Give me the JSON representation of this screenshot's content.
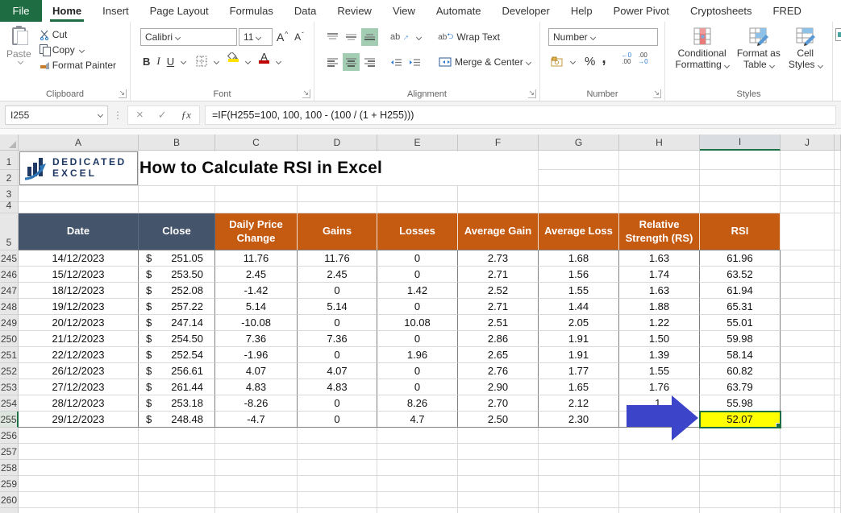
{
  "tabs": {
    "file": "File",
    "items": [
      {
        "label": "Home",
        "active": true
      },
      {
        "label": "Insert",
        "active": false
      },
      {
        "label": "Page Layout",
        "active": false
      },
      {
        "label": "Formulas",
        "active": false
      },
      {
        "label": "Data",
        "active": false
      },
      {
        "label": "Review",
        "active": false
      },
      {
        "label": "View",
        "active": false
      },
      {
        "label": "Automate",
        "active": false
      },
      {
        "label": "Developer",
        "active": false
      },
      {
        "label": "Help",
        "active": false
      },
      {
        "label": "Power Pivot",
        "active": false
      },
      {
        "label": "Cryptosheets",
        "active": false
      },
      {
        "label": "FRED",
        "active": false
      }
    ]
  },
  "ribbon": {
    "clipboard": {
      "title": "Clipboard",
      "paste": "Paste",
      "cut": "Cut",
      "copy": "Copy",
      "format_painter": "Format Painter"
    },
    "font": {
      "title": "Font",
      "font_name": "Calibri",
      "font_size": "11",
      "bold": "B",
      "italic": "I",
      "underline": "U"
    },
    "alignment": {
      "title": "Alignment",
      "wrap_text": "Wrap Text",
      "merge_center": "Merge & Center",
      "ab": "ab"
    },
    "number": {
      "title": "Number",
      "format": "Number",
      "percent": "%",
      "comma": ",",
      "inc_top": "←0",
      "inc_bot": ".00",
      "dec_top": ".00",
      "dec_bot": "→0"
    },
    "styles": {
      "title": "Styles",
      "conditional_line1": "Conditional",
      "conditional_line2": "Formatting",
      "format_table_line1": "Format as",
      "format_table_line2": "Table",
      "cell_styles_line1": "Cell",
      "cell_styles_line2": "Styles"
    }
  },
  "formula_bar": {
    "name_box": "I255",
    "cancel": "×",
    "enter": "✓",
    "fx": "ƒx",
    "formula": "=IF(H255=100, 100, 100 - (100 / (1 + H255)))"
  },
  "sheet": {
    "title": "How to Calculate RSI in Excel",
    "logo": {
      "line1": "DEDICATED",
      "line2": "EXCEL"
    },
    "columns": [
      "A",
      "B",
      "C",
      "D",
      "E",
      "F",
      "G",
      "H",
      "I",
      "J"
    ],
    "selected_column": "I",
    "selected_row": "255",
    "selected_cell": "I255",
    "top_row_numbers": [
      "1",
      "2",
      "3",
      "4",
      "5"
    ],
    "table_headers": [
      "Date",
      "Close",
      "Daily Price Change",
      "Gains",
      "Losses",
      "Average Gain",
      "Average Loss",
      "Relative Strength (RS)",
      "RSI"
    ],
    "currency_symbol": "$",
    "rows": [
      {
        "num": "245",
        "date": "14/12/2023",
        "close": "251.05",
        "values": [
          "11.76",
          "11.76",
          "0",
          "2.73",
          "1.68",
          "1.63",
          "61.96"
        ]
      },
      {
        "num": "246",
        "date": "15/12/2023",
        "close": "253.50",
        "values": [
          "2.45",
          "2.45",
          "0",
          "2.71",
          "1.56",
          "1.74",
          "63.52"
        ]
      },
      {
        "num": "247",
        "date": "18/12/2023",
        "close": "252.08",
        "values": [
          "-1.42",
          "0",
          "1.42",
          "2.52",
          "1.55",
          "1.63",
          "61.94"
        ]
      },
      {
        "num": "248",
        "date": "19/12/2023",
        "close": "257.22",
        "values": [
          "5.14",
          "5.14",
          "0",
          "2.71",
          "1.44",
          "1.88",
          "65.31"
        ]
      },
      {
        "num": "249",
        "date": "20/12/2023",
        "close": "247.14",
        "values": [
          "-10.08",
          "0",
          "10.08",
          "2.51",
          "2.05",
          "1.22",
          "55.01"
        ]
      },
      {
        "num": "250",
        "date": "21/12/2023",
        "close": "254.50",
        "values": [
          "7.36",
          "7.36",
          "0",
          "2.86",
          "1.91",
          "1.50",
          "59.98"
        ]
      },
      {
        "num": "251",
        "date": "22/12/2023",
        "close": "252.54",
        "values": [
          "-1.96",
          "0",
          "1.96",
          "2.65",
          "1.91",
          "1.39",
          "58.14"
        ]
      },
      {
        "num": "252",
        "date": "26/12/2023",
        "close": "256.61",
        "values": [
          "4.07",
          "4.07",
          "0",
          "2.76",
          "1.77",
          "1.55",
          "60.82"
        ]
      },
      {
        "num": "253",
        "date": "27/12/2023",
        "close": "261.44",
        "values": [
          "4.83",
          "4.83",
          "0",
          "2.90",
          "1.65",
          "1.76",
          "63.79"
        ]
      },
      {
        "num": "254",
        "date": "28/12/2023",
        "close": "253.18",
        "values": [
          "-8.26",
          "0",
          "8.26",
          "2.70",
          "2.12",
          "1.",
          "55.98"
        ]
      },
      {
        "num": "255",
        "date": "29/12/2023",
        "close": "248.48",
        "values": [
          "-4.7",
          "0",
          "4.7",
          "2.50",
          "2.30",
          "",
          "52.07"
        ],
        "highlight_rsi": true
      }
    ],
    "empty_row_numbers": [
      "256",
      "257",
      "258",
      "259",
      "260"
    ],
    "colors": {
      "file_tab_green": "#1E6C41",
      "header_dark": "#44546A",
      "header_orange": "#C55A11",
      "highlight_yellow": "#FFFF00",
      "selection_green": "#1D6F42",
      "arrow_blue": "#3C45C9",
      "logo_navy": "#1F3864",
      "logo_swoosh_blue": "#2E75B6"
    }
  }
}
